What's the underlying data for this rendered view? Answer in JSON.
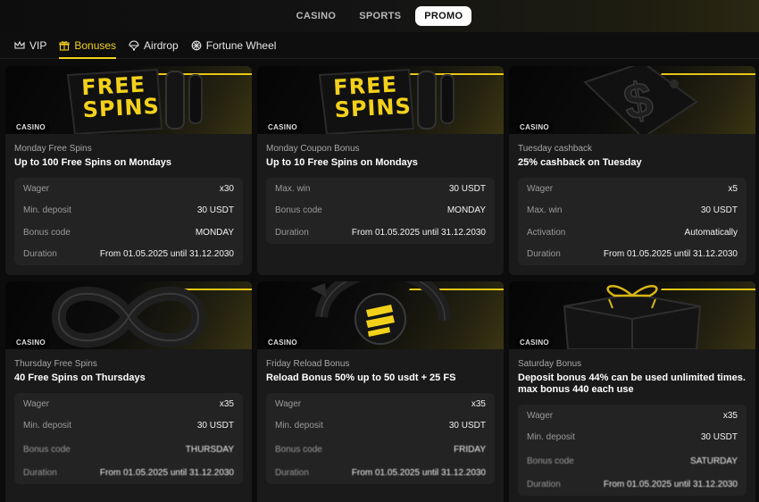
{
  "top_tabs": [
    "CASINO",
    "SPORTS",
    "PROMO"
  ],
  "active_top_tab": "PROMO",
  "sub_tabs": [
    {
      "label": "VIP",
      "icon": "crown-icon"
    },
    {
      "label": "Bonuses",
      "icon": "gift-icon"
    },
    {
      "label": "Airdrop",
      "icon": "parachute-icon"
    },
    {
      "label": "Fortune Wheel",
      "icon": "wheel-icon"
    }
  ],
  "active_sub_tab": "Bonuses",
  "accent_color": "#f3d11b",
  "cards": [
    {
      "tag": "CASINO",
      "banner_text": [
        "FREE",
        "SPINS"
      ],
      "subtitle": "Monday Free Spins",
      "title": "Up to 100 Free Spins on Mondays",
      "rows": [
        {
          "k": "Wager",
          "v": "x30"
        },
        {
          "k": "Min. deposit",
          "v": "30 USDT"
        },
        {
          "k": "Bonus code",
          "v": "MONDAY"
        },
        {
          "k": "Duration",
          "v": "From 01.05.2025 until 31.12.2030"
        }
      ]
    },
    {
      "tag": "CASINO",
      "banner_text": [
        "FREE",
        "SPINS"
      ],
      "subtitle": "Monday Coupon Bonus",
      "title": "Up to 10 Free Spins on Mondays",
      "rows": [
        {
          "k": "Max. win",
          "v": "30 USDT"
        },
        {
          "k": "Bonus code",
          "v": "MONDAY"
        },
        {
          "k": "Duration",
          "v": "From 01.05.2025 until 31.12.2030"
        }
      ]
    },
    {
      "tag": "CASINO",
      "banner_text": [],
      "subtitle": "Tuesday cashback",
      "title": "25% cashback on Tuesday",
      "rows": [
        {
          "k": "Wager",
          "v": "x5"
        },
        {
          "k": "Max. win",
          "v": "30 USDT"
        },
        {
          "k": "Activation",
          "v": "Automatically"
        },
        {
          "k": "Duration",
          "v": "From 01.05.2025 until 31.12.2030"
        }
      ]
    },
    {
      "tag": "CASINO",
      "banner_text": [],
      "subtitle": "Thursday Free Spins",
      "title": "40 Free Spins on Thursdays",
      "rows": [
        {
          "k": "Wager",
          "v": "x35"
        },
        {
          "k": "Min. deposit",
          "v": "30 USDT"
        },
        {
          "k": "Bonus code",
          "v": "THURSDAY"
        },
        {
          "k": "Duration",
          "v": "From 01.05.2025 until 31.12.2030"
        }
      ]
    },
    {
      "tag": "CASINO",
      "banner_text": [],
      "subtitle": "Friday Reload Bonus",
      "title": "Reload Bonus 50% up to 50 usdt + 25 FS",
      "rows": [
        {
          "k": "Wager",
          "v": "x35"
        },
        {
          "k": "Min. deposit",
          "v": "30 USDT"
        },
        {
          "k": "Bonus code",
          "v": "FRIDAY"
        },
        {
          "k": "Duration",
          "v": "From 01.05.2025 until 31.12.2030"
        }
      ]
    },
    {
      "tag": "CASINO",
      "banner_text": [],
      "subtitle": "Saturday Bonus",
      "title": "Deposit bonus 44% can be used unlimited times. max bonus 440 each use",
      "rows": [
        {
          "k": "Wager",
          "v": "x35"
        },
        {
          "k": "Min. deposit",
          "v": "30 USDT"
        },
        {
          "k": "Bonus code",
          "v": "SATURDAY"
        },
        {
          "k": "Duration",
          "v": "From 01.05.2025 until 31.12.2030"
        }
      ]
    }
  ]
}
